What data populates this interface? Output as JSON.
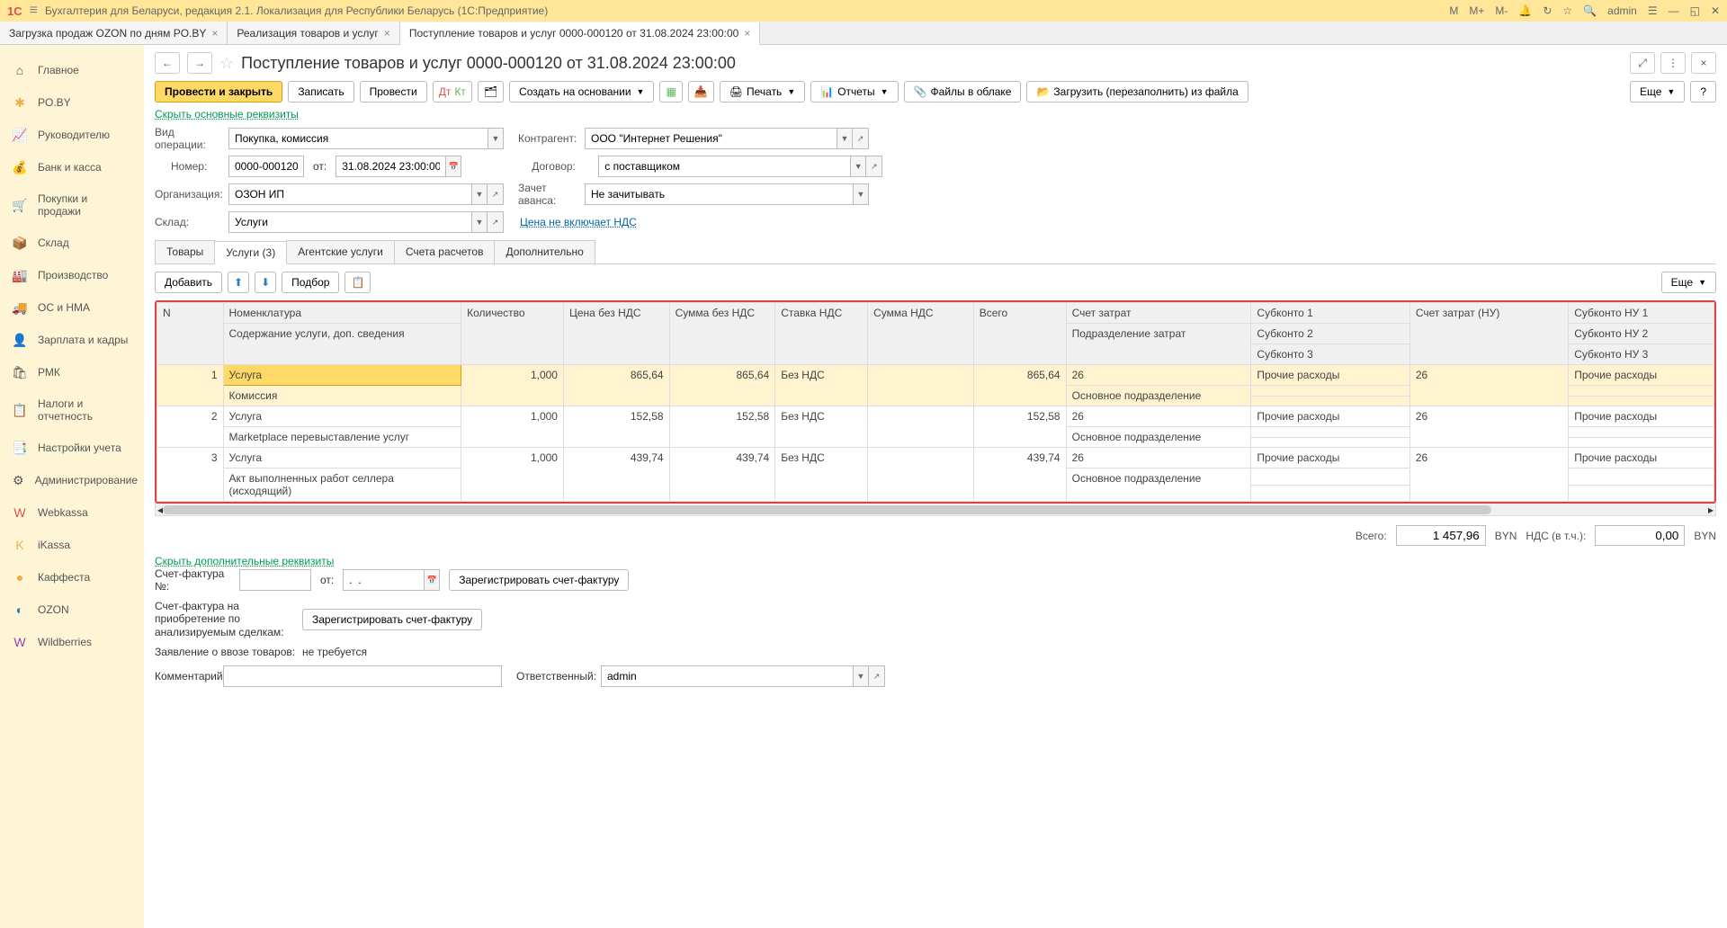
{
  "titlebar": {
    "app_title": "Бухгалтерия для Беларуси, редакция 2.1. Локализация для Республики Беларусь  (1С:Предприятие)",
    "user": "admin",
    "m": "M",
    "mplus": "M+",
    "mminus": "M-"
  },
  "tabs": [
    {
      "label": "Загрузка продаж OZON по дням PO.BY",
      "active": false
    },
    {
      "label": "Реализация товаров и услуг",
      "active": false
    },
    {
      "label": "Поступление товаров и услуг 0000-000120 от 31.08.2024 23:00:00",
      "active": true
    }
  ],
  "sidebar": [
    {
      "icon": "⌂",
      "label": "Главное",
      "color": ""
    },
    {
      "icon": "✱",
      "label": "PO.BY",
      "color": "ic-orange"
    },
    {
      "icon": "📈",
      "label": "Руководителю",
      "color": ""
    },
    {
      "icon": "💰",
      "label": "Банк и касса",
      "color": ""
    },
    {
      "icon": "🛒",
      "label": "Покупки и продажи",
      "color": ""
    },
    {
      "icon": "📦",
      "label": "Склад",
      "color": ""
    },
    {
      "icon": "🏭",
      "label": "Производство",
      "color": ""
    },
    {
      "icon": "🚚",
      "label": "ОС и НМА",
      "color": ""
    },
    {
      "icon": "👤",
      "label": "Зарплата и кадры",
      "color": ""
    },
    {
      "icon": "🛍",
      "label": "РМК",
      "color": ""
    },
    {
      "icon": "📋",
      "label": "Налоги и отчетность",
      "color": ""
    },
    {
      "icon": "📑",
      "label": "Настройки учета",
      "color": ""
    },
    {
      "icon": "⚙",
      "label": "Администрирование",
      "color": ""
    },
    {
      "icon": "W",
      "label": "Webkassa",
      "color": "ic-red"
    },
    {
      "icon": "K",
      "label": "iKassa",
      "color": "ic-orange"
    },
    {
      "icon": "●",
      "label": "Каффеста",
      "color": "ic-orange"
    },
    {
      "icon": "◐",
      "label": "OZON",
      "color": "ic-blue"
    },
    {
      "icon": "W",
      "label": "Wildberries",
      "color": "ic-purple"
    }
  ],
  "page": {
    "title": "Поступление товаров и услуг 0000-000120 от 31.08.2024 23:00:00",
    "back": "←",
    "fwd": "→"
  },
  "toolbar": {
    "post_close": "Провести и закрыть",
    "write": "Записать",
    "post": "Провести",
    "create_based": "Создать на основании",
    "print": "Печать",
    "reports": "Отчеты",
    "files": "Файлы в облаке",
    "reload": "Загрузить (перезаполнить) из файла",
    "more": "Еще",
    "help": "?"
  },
  "links": {
    "hide_main": "Скрыть основные реквизиты",
    "price_vat": "Цена не включает НДС",
    "hide_add": "Скрыть дополнительные реквизиты"
  },
  "form": {
    "op_type_label": "Вид операции:",
    "op_type": "Покупка, комиссия",
    "number_label": "Номер:",
    "number": "0000-000120",
    "from_label": "от:",
    "date": "31.08.2024 23:00:00",
    "org_label": "Организация:",
    "org": "ОЗОН ИП",
    "wh_label": "Склад:",
    "wh": "Услуги",
    "partner_label": "Контрагент:",
    "partner": "ООО \"Интернет Решения\"",
    "contract_label": "Договор:",
    "contract": "с поставщиком",
    "advance_label": "Зачет аванса:",
    "advance": "Не зачитывать"
  },
  "doc_tabs": [
    {
      "label": "Товары"
    },
    {
      "label": "Услуги (3)",
      "active": true
    },
    {
      "label": "Агентские услуги"
    },
    {
      "label": "Счета расчетов"
    },
    {
      "label": "Дополнительно"
    }
  ],
  "table_toolbar": {
    "add": "Добавить",
    "select": "Подбор",
    "more": "Еще"
  },
  "grid": {
    "headers": {
      "n": "N",
      "nomen": "Номенклатура",
      "content": "Содержание услуги, доп. сведения",
      "qty": "Количество",
      "price": "Цена без НДС",
      "sum": "Сумма без НДС",
      "vat_rate": "Ставка НДС",
      "vat_sum": "Сумма НДС",
      "total": "Всего",
      "cost_acc": "Счет затрат",
      "dept": "Подразделение затрат",
      "sub1": "Субконто 1",
      "sub2": "Субконто 2",
      "sub3": "Субконто 3",
      "cost_acc_nu": "Счет затрат (НУ)",
      "subnu1": "Субконто НУ 1",
      "subnu2": "Субконто НУ 2",
      "subnu3": "Субконто НУ 3"
    },
    "rows": [
      {
        "n": "1",
        "nomen": "Услуга",
        "content": "Комиссия",
        "qty": "1,000",
        "price": "865,64",
        "sum": "865,64",
        "vat_rate": "Без НДС",
        "vat_sum": "",
        "total": "865,64",
        "cost_acc": "26",
        "dept": "Основное подразделение",
        "sub1": "Прочие расходы",
        "cost_acc_nu": "26",
        "subnu1": "Прочие расходы",
        "selected": true
      },
      {
        "n": "2",
        "nomen": "Услуга",
        "content": "Marketplace перевыставление услуг",
        "qty": "1,000",
        "price": "152,58",
        "sum": "152,58",
        "vat_rate": "Без НДС",
        "vat_sum": "",
        "total": "152,58",
        "cost_acc": "26",
        "dept": "Основное подразделение",
        "sub1": "Прочие расходы",
        "cost_acc_nu": "26",
        "subnu1": "Прочие расходы"
      },
      {
        "n": "3",
        "nomen": "Услуга",
        "content": "Акт выполненных работ селлера (исходящий)",
        "qty": "1,000",
        "price": "439,74",
        "sum": "439,74",
        "vat_rate": "Без НДС",
        "vat_sum": "",
        "total": "439,74",
        "cost_acc": "26",
        "dept": "Основное подразделение",
        "sub1": "Прочие расходы",
        "cost_acc_nu": "26",
        "subnu1": "Прочие расходы"
      }
    ]
  },
  "footer": {
    "total_label": "Всего:",
    "total": "1 457,96",
    "cur": "BYN",
    "vat_label": "НДС (в т.ч.):",
    "vat": "0,00",
    "cur2": "BYN"
  },
  "bottom": {
    "invoice_label": "Счет-фактура №:",
    "invoice_from": "от:",
    "invoice_date": ".  .",
    "reg_invoice": "Зарегистрировать счет-фактуру",
    "invoice_note": "Счет-фактура на приобретение по анализируемым сделкам:",
    "reg_invoice2": "Зарегистрировать счет-фактуру",
    "import_label": "Заявление о ввозе товаров:",
    "import_val": "не требуется",
    "comment_label": "Комментарий:",
    "resp_label": "Ответственный:",
    "resp": "admin"
  }
}
